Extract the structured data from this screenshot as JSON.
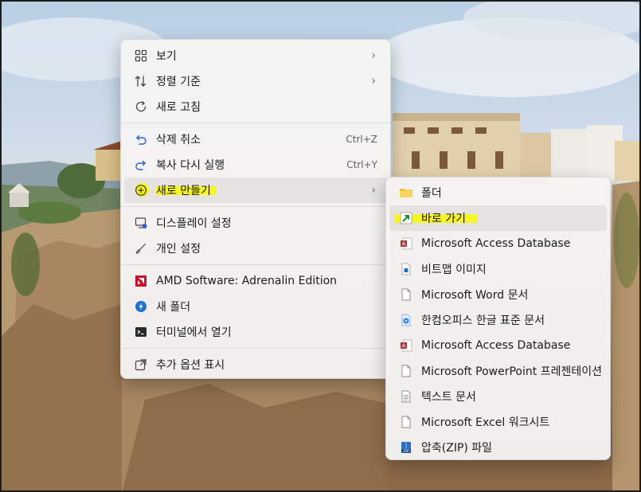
{
  "main_menu": {
    "items": [
      {
        "label": "보기",
        "icon": "view-grid-icon",
        "submenu": true
      },
      {
        "label": "정렬 기준",
        "icon": "sort-icon",
        "submenu": true
      },
      {
        "label": "새로 고침",
        "icon": "refresh-icon"
      },
      {
        "label": "삭제 취소",
        "icon": "undo-icon",
        "shortcut": "Ctrl+Z"
      },
      {
        "label": "복사 다시 실행",
        "icon": "redo-icon",
        "shortcut": "Ctrl+Y"
      },
      {
        "label": "새로 만들기",
        "icon": "new-plus-icon",
        "submenu": true,
        "active": true
      },
      {
        "label": "디스플레이 설정",
        "icon": "display-settings-icon"
      },
      {
        "label": "개인 설정",
        "icon": "brush-icon"
      },
      {
        "label": "AMD Software: Adrenalin Edition",
        "icon": "amd-icon"
      },
      {
        "label": "새 폴더",
        "icon": "new-folder-app-icon"
      },
      {
        "label": "터미널에서 열기",
        "icon": "terminal-icon"
      },
      {
        "label": "추가 옵션 표시",
        "icon": "more-options-icon"
      }
    ]
  },
  "sub_menu": {
    "items": [
      {
        "label": "폴더",
        "icon": "folder-icon"
      },
      {
        "label": "바로 가기",
        "icon": "shortcut-arrow-icon"
      },
      {
        "label": "Microsoft Access Database",
        "icon": "access-icon"
      },
      {
        "label": "비트맵 이미지",
        "icon": "bitmap-icon"
      },
      {
        "label": "Microsoft Word 문서",
        "icon": "document-icon"
      },
      {
        "label": "한컴오피스 한글 표준 문서",
        "icon": "hwp-icon"
      },
      {
        "label": "Microsoft Access Database",
        "icon": "access-icon"
      },
      {
        "label": "Microsoft PowerPoint 프레젠테이션",
        "icon": "document-icon"
      },
      {
        "label": "텍스트 문서",
        "icon": "text-document-icon"
      },
      {
        "label": "Microsoft Excel 워크시트",
        "icon": "document-icon"
      },
      {
        "label": "압축(ZIP) 파일",
        "icon": "zip-icon"
      }
    ]
  },
  "shortcuts": {
    "undo": "Ctrl+Z",
    "redo": "Ctrl+Y"
  },
  "colors": {
    "highlight": "#f5f516",
    "accent": "#2a62c9",
    "menu_bg": "#f5f4f2"
  }
}
